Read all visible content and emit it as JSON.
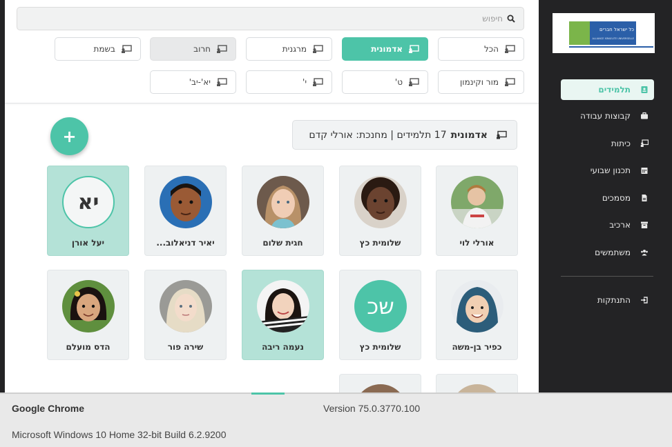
{
  "search": {
    "placeholder": "חיפוש"
  },
  "filters": {
    "row1": [
      "הכל",
      "אדמונית",
      "מרגנית",
      "חרוב",
      "בשמת"
    ],
    "row2": [
      "מור וקינמון",
      "ט'",
      "י'",
      "יא'-יב'"
    ],
    "active": "אדמונית"
  },
  "classbar": {
    "name": "אדמונית",
    "details": "17 תלמידים | מחנכת: אורלי קדם"
  },
  "fab": {
    "label": "+"
  },
  "students": {
    "row1": [
      {
        "name": "אורלי לוי",
        "initials": ""
      },
      {
        "name": "שלומית כץ",
        "initials": ""
      },
      {
        "name": "חגית שלום",
        "initials": ""
      },
      {
        "name": "יאיר דניאלוב...",
        "initials": ""
      },
      {
        "name": "יעל אורן",
        "initials": "יא"
      }
    ],
    "row2": [
      {
        "name": "כפיר בן-משה",
        "initials": ""
      },
      {
        "name": "שלומית כץ",
        "initials": "שכ"
      },
      {
        "name": "נעמה ריבה",
        "initials": ""
      },
      {
        "name": "שירה פור",
        "initials": ""
      },
      {
        "name": "הדס מועלם",
        "initials": ""
      }
    ]
  },
  "sidebar": {
    "logo_text": "כל ישראל חברים",
    "logo_subtext": "ALLIANCE ISRAELITE UNIVERSELLE",
    "items": [
      {
        "label": "תלמידים",
        "icon": "id-card-icon"
      },
      {
        "label": "קבוצות עבודה",
        "icon": "briefcase-icon"
      },
      {
        "label": "כיתות",
        "icon": "classroom-icon"
      },
      {
        "label": "תכנון שבועי",
        "icon": "calendar-icon"
      },
      {
        "label": "מסמכים",
        "icon": "document-icon"
      },
      {
        "label": "ארכיב",
        "icon": "archive-icon"
      },
      {
        "label": "משתמשים",
        "icon": "users-icon"
      }
    ],
    "logout": "התנתקות"
  },
  "info": {
    "browser": "Google Chrome",
    "version": "Version 75.0.3770.100",
    "os": "Microsoft Windows 10 Home 32-bit Build 6.2.9200"
  },
  "colors": {
    "accent": "#4dc4a8",
    "sidebar": "#232325",
    "card": "#eef1f2",
    "selected_card": "#b4e2d7"
  }
}
